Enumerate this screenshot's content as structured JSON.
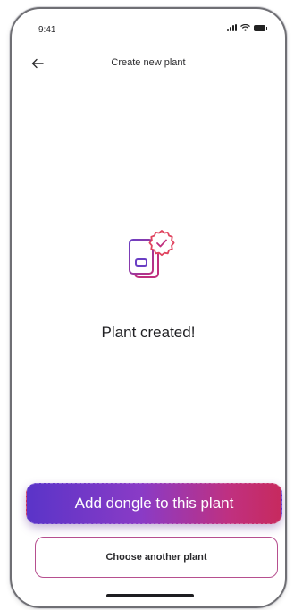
{
  "status_bar": {
    "time": "9:41",
    "icons": [
      "signal-icon",
      "wifi-icon",
      "battery-icon"
    ]
  },
  "nav": {
    "back_icon": "arrow-left-icon",
    "title": "Create new plant"
  },
  "success": {
    "icon": "document-check-badge-icon",
    "message": "Plant created!"
  },
  "actions": {
    "primary_label": "Add dongle to this plant",
    "secondary_label": "Choose another plant"
  },
  "colors": {
    "gradient_start": "#5a34c8",
    "gradient_end": "#c72a5e",
    "outline": "#b64f8f",
    "icon_accent": "#e0445f",
    "icon_primary": "#6a3fc4"
  }
}
